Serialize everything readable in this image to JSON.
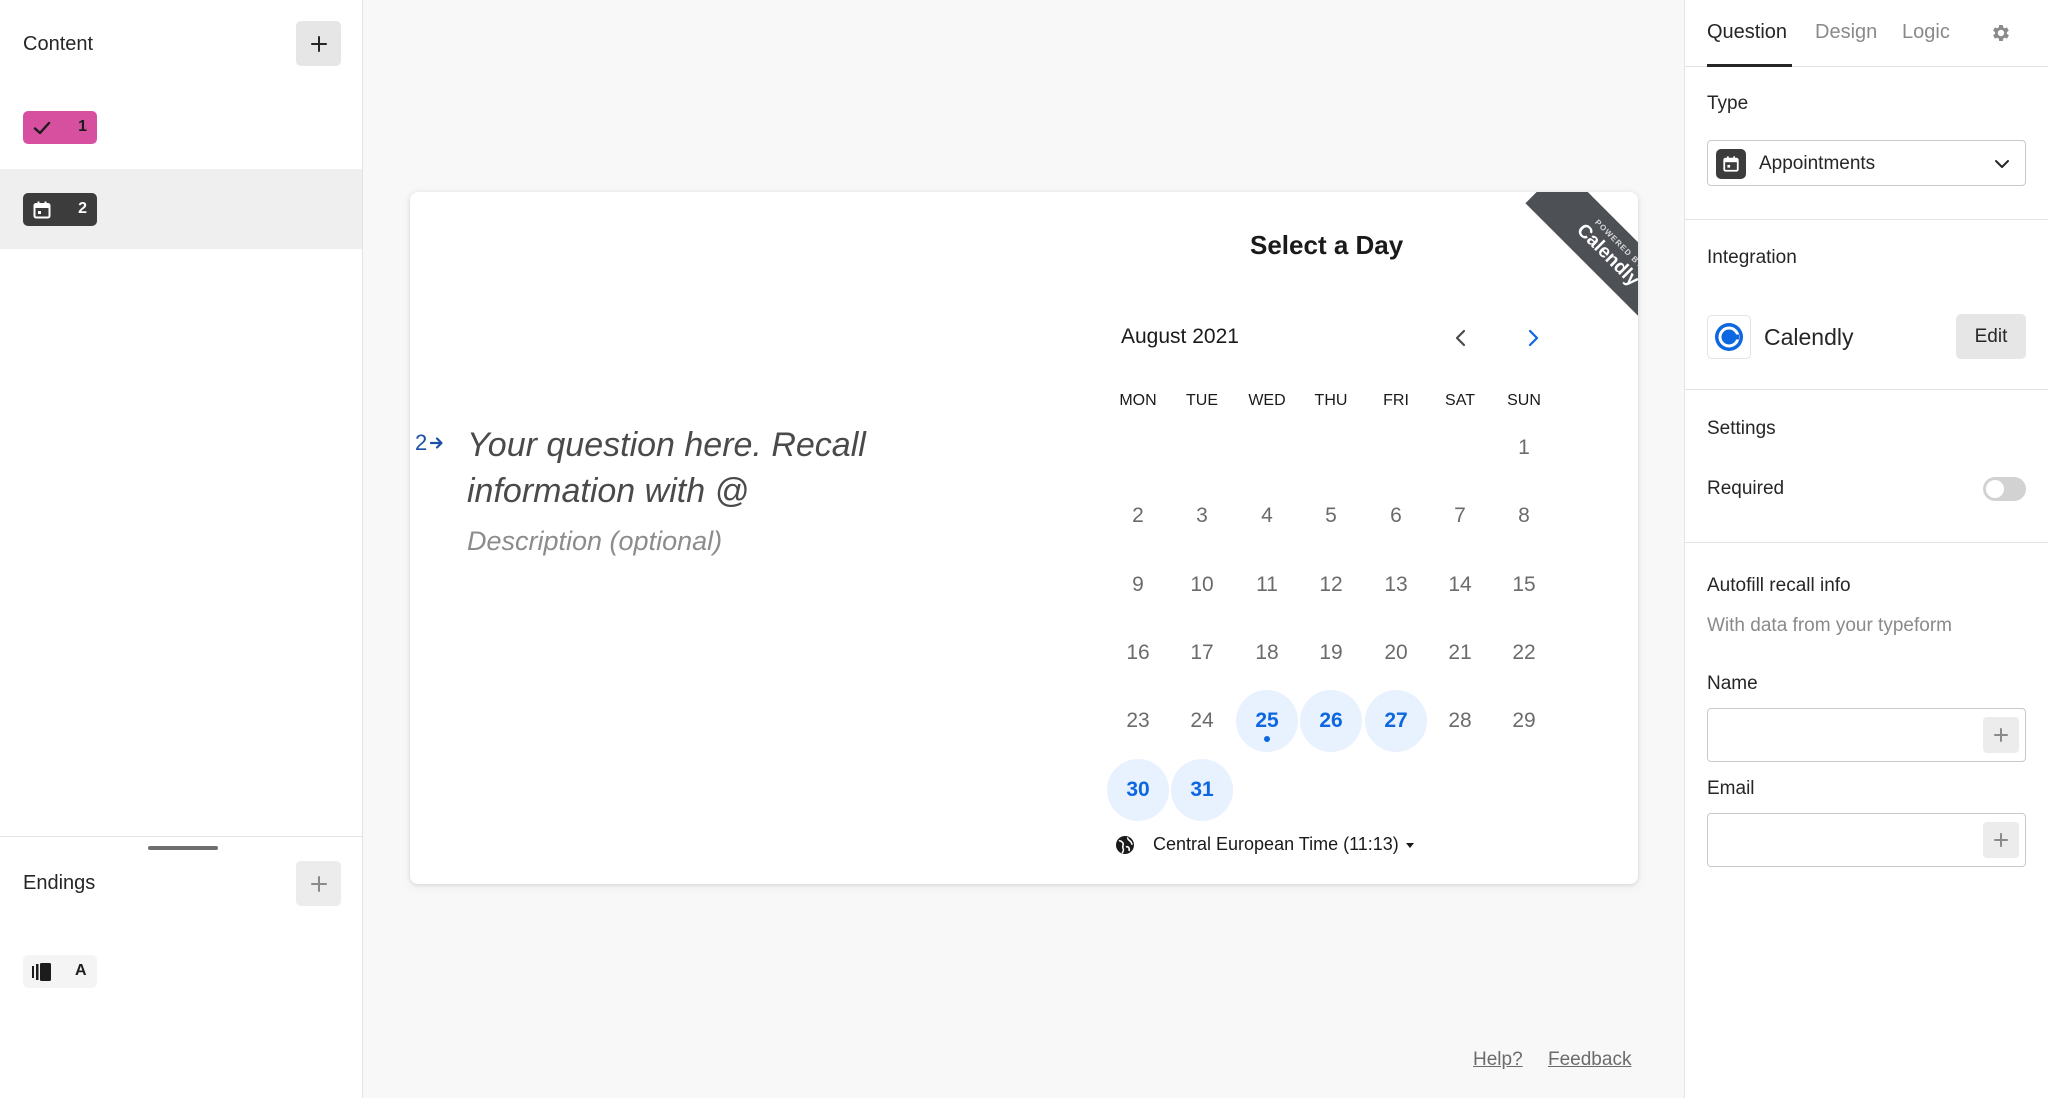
{
  "sidebar": {
    "content_title": "Content",
    "questions": [
      {
        "number": "1",
        "type_icon": "checkmark-icon",
        "color": "#d6509f"
      },
      {
        "number": "2",
        "type_icon": "calendar-icon",
        "color": "#3c3c3c"
      }
    ],
    "endings_title": "Endings",
    "endings": [
      {
        "letter": "A",
        "icon": "ending-screen-icon"
      }
    ]
  },
  "question": {
    "number": "2",
    "text": "Your question here. Recall information with @",
    "description_placeholder": "Description (optional)"
  },
  "calendar": {
    "title": "Select a Day",
    "ribbon_small": "POWERED BY",
    "ribbon_big": "Calendly",
    "month": "August 2021",
    "weekdays": [
      "MON",
      "TUE",
      "WED",
      "THU",
      "FRI",
      "SAT",
      "SUN"
    ],
    "days": [
      "1",
      "2",
      "3",
      "4",
      "5",
      "6",
      "7",
      "8",
      "9",
      "10",
      "11",
      "12",
      "13",
      "14",
      "15",
      "16",
      "17",
      "18",
      "19",
      "20",
      "21",
      "22",
      "23",
      "24",
      "25",
      "26",
      "27",
      "28",
      "29",
      "30",
      "31"
    ],
    "available_days": [
      "25",
      "26",
      "27",
      "30",
      "31"
    ],
    "today": "25",
    "timezone": "Central European Time (11:13)",
    "accent_color": "#0c67e0",
    "available_bg": "#e8f1fe"
  },
  "footer": {
    "help": "Help?",
    "feedback": "Feedback"
  },
  "panel": {
    "tabs": [
      "Question",
      "Design",
      "Logic"
    ],
    "active_tab": "Question",
    "type_label": "Type",
    "type_value": "Appointments",
    "integration_label": "Integration",
    "integration_name": "Calendly",
    "edit_label": "Edit",
    "settings_label": "Settings",
    "required_label": "Required",
    "required_on": false,
    "autofill_title": "Autofill recall info",
    "autofill_sub": "With data from your typeform",
    "name_label": "Name",
    "name_value": "",
    "email_label": "Email",
    "email_value": ""
  }
}
